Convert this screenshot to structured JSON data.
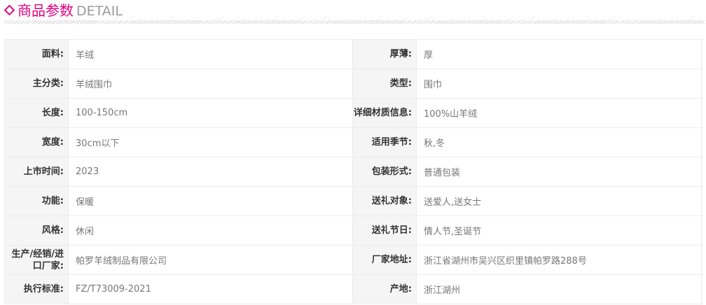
{
  "header": {
    "title_cn": "商品参数",
    "title_en": "DETAIL",
    "accent_color": "#e4007f"
  },
  "params": [
    {
      "left_label": "面料:",
      "left_value": "羊绒",
      "right_label": "厚薄:",
      "right_value": "厚"
    },
    {
      "left_label": "主分类:",
      "left_value": "羊绒围巾",
      "right_label": "类型:",
      "right_value": "围巾"
    },
    {
      "left_label": "长度:",
      "left_value": "100-150cm",
      "right_label": "详细材质信息:",
      "right_value": "100%山羊绒"
    },
    {
      "left_label": "宽度:",
      "left_value": "30cm以下",
      "right_label": "适用季节:",
      "right_value": "秋,冬"
    },
    {
      "left_label": "上市时间:",
      "left_value": "2023",
      "right_label": "包装形式:",
      "right_value": "普通包装"
    },
    {
      "left_label": "功能:",
      "left_value": "保暖",
      "right_label": "送礼对象:",
      "right_value": "送爱人,送女士"
    },
    {
      "left_label": "风格:",
      "left_value": "休闲",
      "right_label": "送礼节日:",
      "right_value": "情人节,圣诞节"
    },
    {
      "left_label": "生产/经销/进口厂家:",
      "left_value": "帕罗羊绒制品有限公司",
      "right_label": "厂家地址:",
      "right_value": "浙江省湖州市吴兴区织里镇帕罗路288号"
    },
    {
      "left_label": "执行标准:",
      "left_value": "FZ/T73009-2021",
      "right_label": "产地:",
      "right_value": "浙江湖州"
    }
  ]
}
